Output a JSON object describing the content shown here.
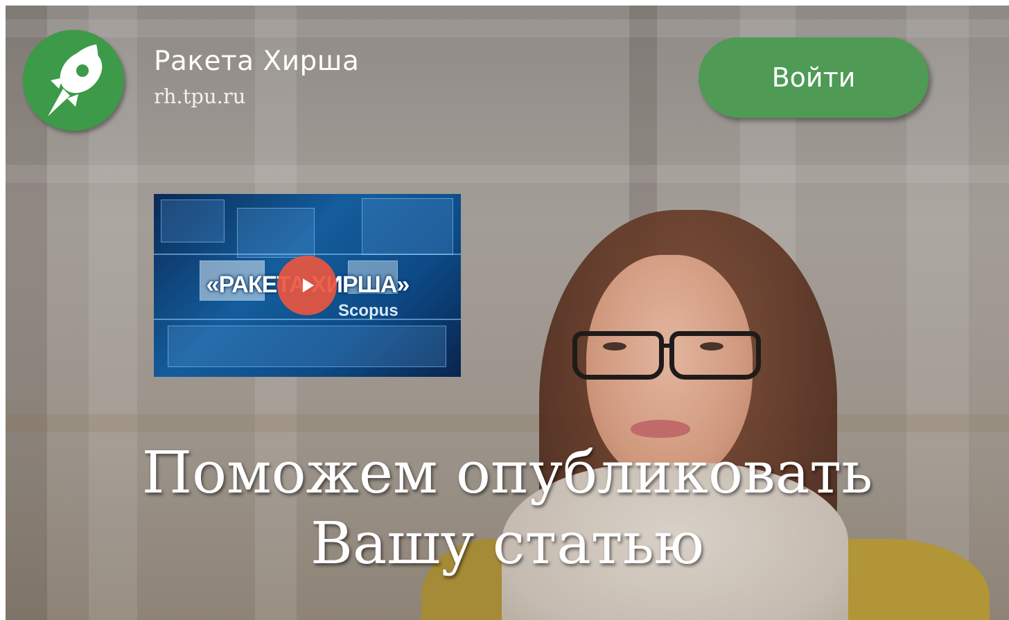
{
  "header": {
    "brand_name": "Ракета Хирша",
    "brand_url": "rh.tpu.ru",
    "login_label": "Войти"
  },
  "video": {
    "title": "«РАКЕТА ХИРША»",
    "subtitle": "Scopus"
  },
  "hero": {
    "headline_line1": "Поможем опубликовать",
    "headline_line2": "Вашу статью"
  },
  "icons": {
    "logo": "rocket-icon",
    "play": "play-icon"
  },
  "colors": {
    "brand_green": "#3c9a49",
    "button_green": "#4f9a55",
    "play_red": "#e85641"
  }
}
